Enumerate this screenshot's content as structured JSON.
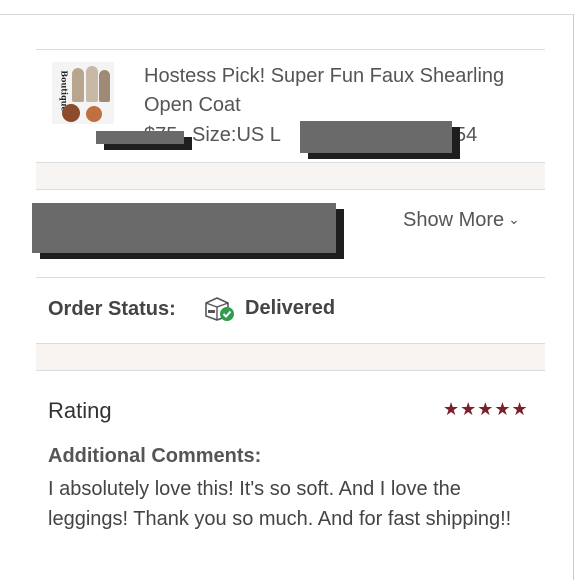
{
  "product": {
    "thumbnail_brand": "Boutique",
    "title": "Hostess Pick! Super Fun Faux Shearling Open Coat",
    "price": "$75",
    "size_label": "Size:US L",
    "tail_text": "54"
  },
  "details": {
    "show_more_label": "Show More",
    "chevron_icon": "chevron-down-icon"
  },
  "order_status": {
    "label": "Order Status:",
    "value": "Delivered",
    "icon": "delivered-box-icon",
    "check_color": "#2e9e4e"
  },
  "rating": {
    "label": "Rating",
    "stars": 5,
    "stars_text": "★★★★★",
    "star_color": "#7a1f2b",
    "comments_label": "Additional Comments:",
    "comments_text": "I absolutely love this! It's so soft. And I love the leggings! Thank you so much. And for fast shipping!!"
  }
}
